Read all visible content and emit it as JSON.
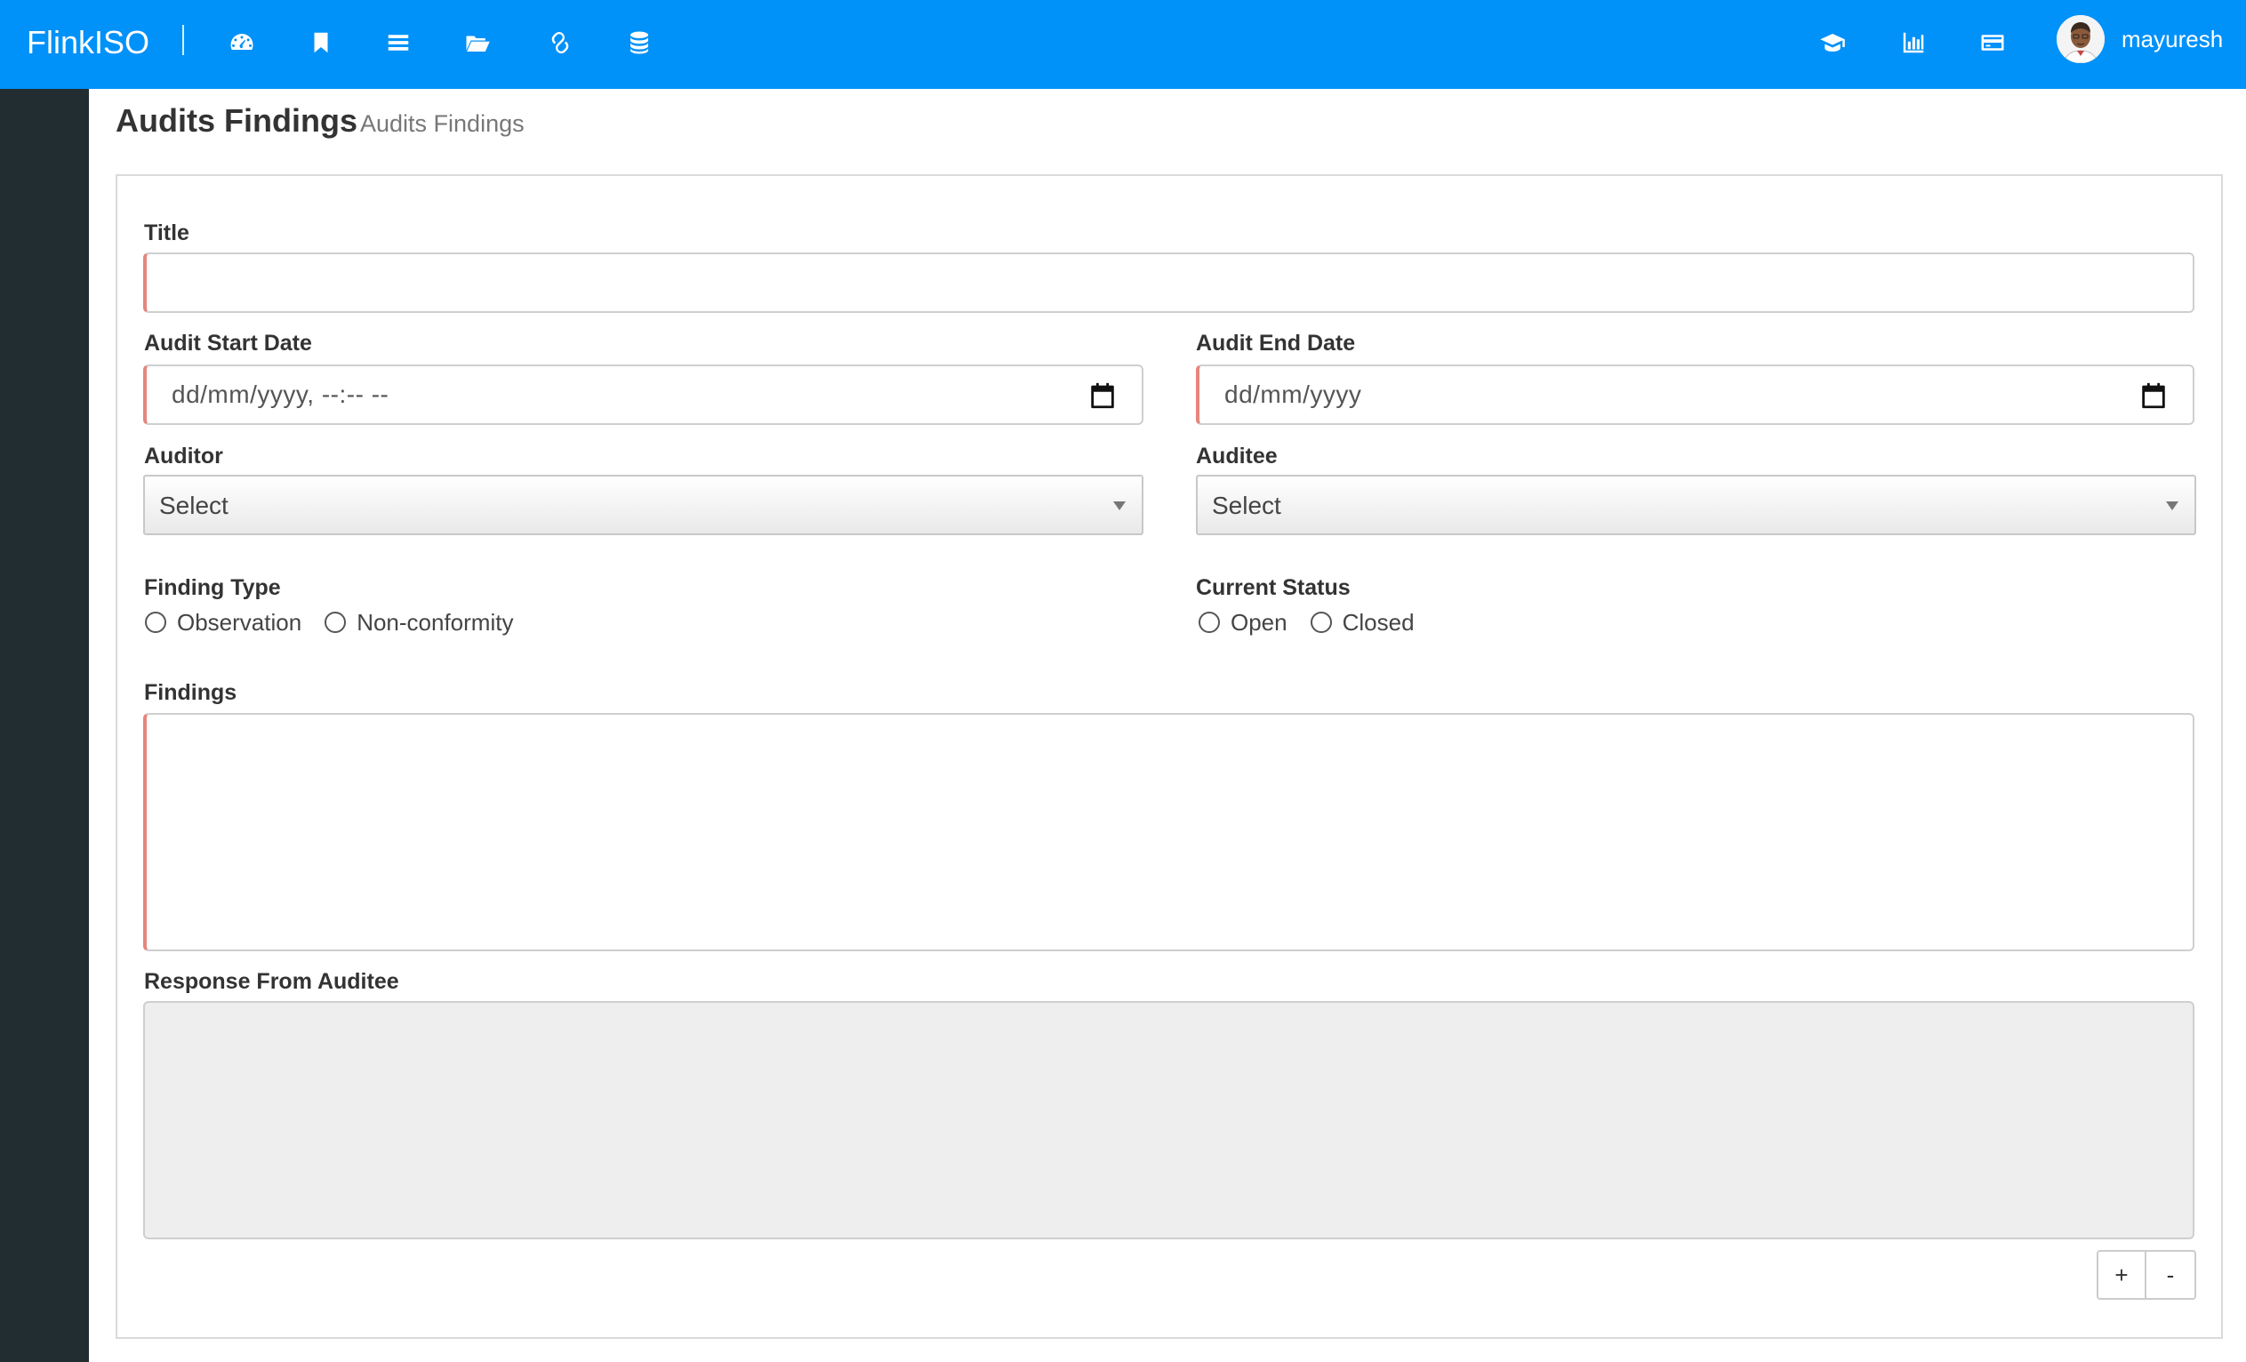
{
  "header": {
    "brand": "FlinkISO",
    "nav_icons": [
      "dashboard-icon",
      "bookmark-icon",
      "list-icon",
      "folder-open-icon",
      "link-icon",
      "database-icon"
    ],
    "right_icons": [
      "graduation-cap-icon",
      "bar-chart-icon",
      "credit-card-icon"
    ],
    "user_name": "mayuresh",
    "color": "#0091f9"
  },
  "page": {
    "title": "Audits Findings",
    "subtitle": "Audits Findings"
  },
  "form": {
    "title_label": "Title",
    "title_value": "",
    "audit_start_label": "Audit Start Date",
    "audit_start_placeholder": "dd/mm/yyyy, --:-- --",
    "audit_end_label": "Audit End Date",
    "audit_end_placeholder": "dd/mm/yyyy",
    "auditor_label": "Auditor",
    "auditor_value": "Select",
    "auditee_label": "Auditee",
    "auditee_value": "Select",
    "finding_type_label": "Finding Type",
    "finding_type_options": [
      "Observation",
      "Non-conformity"
    ],
    "current_status_label": "Current Status",
    "current_status_options": [
      "Open",
      "Closed"
    ],
    "findings_label": "Findings",
    "findings_value": "",
    "response_label": "Response From Auditee",
    "response_value": "",
    "add_button": "+",
    "remove_button": "-"
  }
}
